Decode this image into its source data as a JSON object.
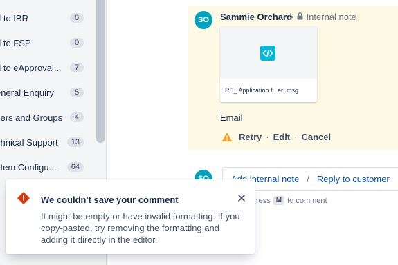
{
  "sidebar": {
    "items": [
      {
        "label": "d to IBR",
        "count": "0"
      },
      {
        "label": "d to FSP",
        "count": "0"
      },
      {
        "label": "d to eApproval...",
        "count": "7"
      },
      {
        "label": "eneral Enquiry",
        "count": "5"
      },
      {
        "label": "sers and Groups",
        "count": "4"
      },
      {
        "label": "chnical Support",
        "count": "13"
      },
      {
        "label": "stem Configu...",
        "count": "64"
      }
    ]
  },
  "comment": {
    "avatar_initials": "SO",
    "author": "Sammie Orchard",
    "visibility": "Internal note",
    "attachment": {
      "name": "RE_ Application f...er .msg",
      "icon": "code-file-icon"
    },
    "body": "Email",
    "actions": {
      "retry": "Retry",
      "edit": "Edit",
      "cancel": "Cancel"
    },
    "colors": {
      "background": "#fffae6",
      "avatar": "#00a3bf",
      "warning": "#ff991f"
    }
  },
  "composer": {
    "avatar_initials": "SO",
    "add_internal_note": "Add internal note",
    "separator": "/",
    "reply_to_customer": "Reply to customer",
    "hint_prefix": "ress",
    "hint_key": "M",
    "hint_suffix": "to comment"
  },
  "flag": {
    "title": "We couldn't save your comment",
    "message": "It might be empty or have invalid formatting. If you copy-pasted, try removing the formatting and adding it directly in the editor.",
    "icon": "error-icon",
    "colors": {
      "error": "#de350b"
    }
  }
}
